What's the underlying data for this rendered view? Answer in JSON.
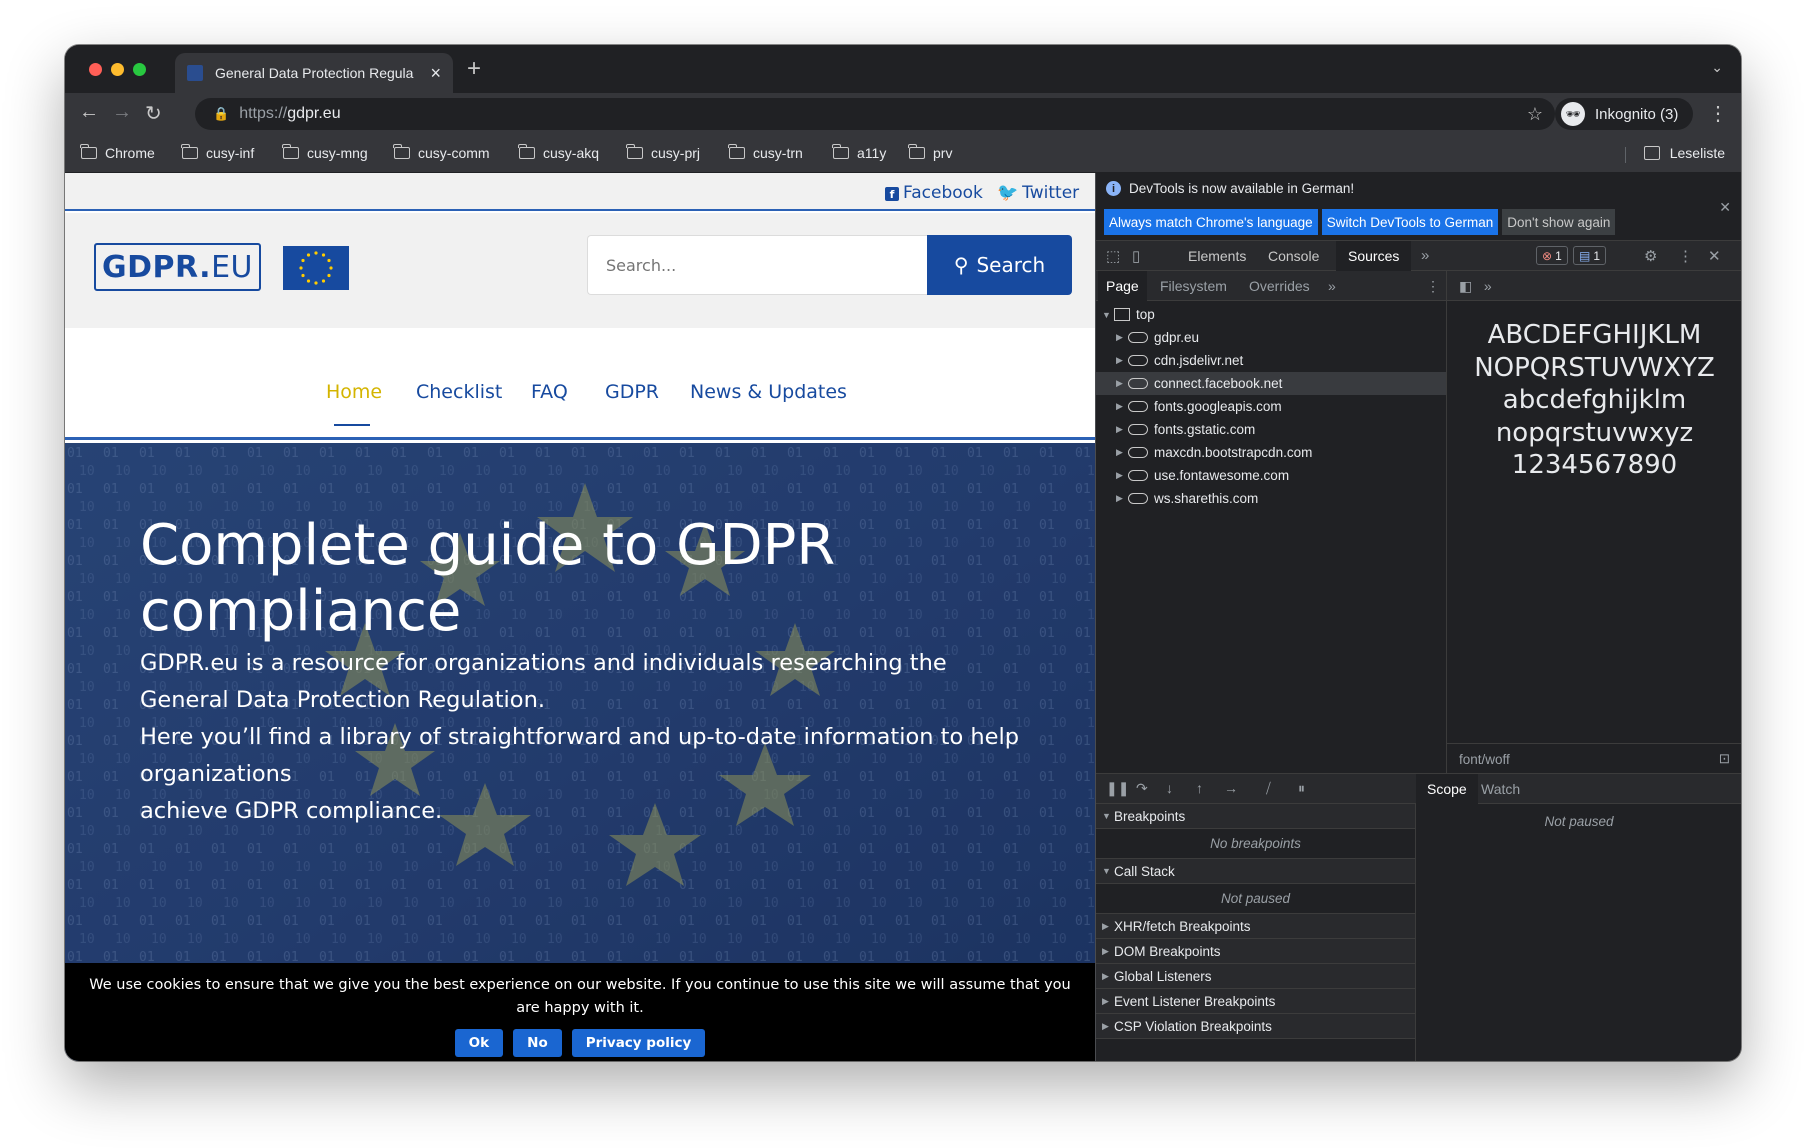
{
  "browser": {
    "tab_title": "General Data Protection Regula",
    "url_scheme": "https://",
    "url_host": "gdpr.eu",
    "profile_label": "Inkognito (3)",
    "bookmarks": [
      "Chrome",
      "cusy-inf",
      "cusy-mng",
      "cusy-comm",
      "cusy-akq",
      "cusy-prj",
      "cusy-trn",
      "a11y",
      "prv"
    ],
    "reading_list": "Leseliste"
  },
  "site": {
    "social": {
      "facebook": "Facebook",
      "twitter": "Twitter"
    },
    "logo_bold": "GDPR.",
    "logo_light": "EU",
    "search_placeholder": "Search...",
    "search_button": "Search",
    "nav": [
      "Home",
      "Checklist",
      "FAQ",
      "GDPR",
      "News & Updates"
    ],
    "hero_title": "Complete guide to GDPR compliance",
    "hero_p1": "GDPR.eu is a resource for organizations and individuals researching the General Data Protection Regulation.",
    "hero_p2": "Here you’ll find a library of straightforward and up-to-date information to help organizations",
    "hero_p3": "achieve GDPR compliance.",
    "cookie_text": "We use cookies to ensure that we give you the best experience on our website. If you continue to use this site we will assume that you are happy with it.",
    "cookie_ok": "Ok",
    "cookie_no": "No",
    "cookie_privacy": "Privacy policy"
  },
  "devtools": {
    "info_text": "DevTools is now available in German!",
    "btn_match": "Always match Chrome's language",
    "btn_switch": "Switch DevTools to German",
    "btn_dont": "Don't show again",
    "tabs": [
      "Elements",
      "Console",
      "Sources"
    ],
    "error_count": "1",
    "message_count": "1",
    "sub_tabs": [
      "Page",
      "Filesystem",
      "Overrides"
    ],
    "tree_root": "top",
    "tree": [
      "gdpr.eu",
      "cdn.jsdelivr.net",
      "connect.facebook.net",
      "fonts.googleapis.com",
      "fonts.gstatic.com",
      "maxcdn.bootstrapcdn.com",
      "use.fontawesome.com",
      "ws.sharethis.com"
    ],
    "font_preview": [
      "ABCDEFGHIJKLM",
      "NOPQRSTUVWXYZ",
      "abcdefghijklm",
      "nopqrstuvwxyz",
      "1234567890"
    ],
    "mime": "font/woff",
    "breakpoints": "Breakpoints",
    "no_breakpoints": "No breakpoints",
    "call_stack": "Call Stack",
    "not_paused": "Not paused",
    "sections": [
      "XHR/fetch Breakpoints",
      "DOM Breakpoints",
      "Global Listeners",
      "Event Listener Breakpoints",
      "CSP Violation Breakpoints"
    ],
    "scope": "Scope",
    "watch": "Watch",
    "scope_not_paused": "Not paused"
  },
  "colors": {
    "brand_blue": "#174a9f",
    "active_nav": "#d4b400",
    "devtools_bg": "#202124"
  }
}
